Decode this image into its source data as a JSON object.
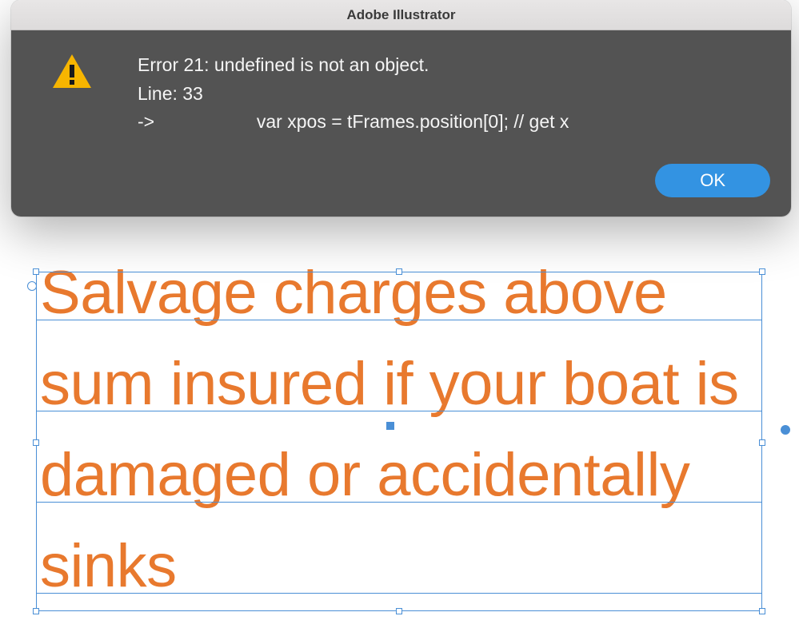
{
  "dialog": {
    "title": "Adobe Illustrator",
    "error_line1": "Error 21: undefined is not an object.",
    "error_line2": "Line: 33",
    "error_line3": "->                    var xpos = tFrames.position[0]; // get x",
    "ok_label": "OK"
  },
  "canvas": {
    "text_content": "Salvage charges above sum insured if your boat is damaged or accidentally sinks",
    "text_color": "#e8792e",
    "selection_color": "#4a8fd6"
  }
}
